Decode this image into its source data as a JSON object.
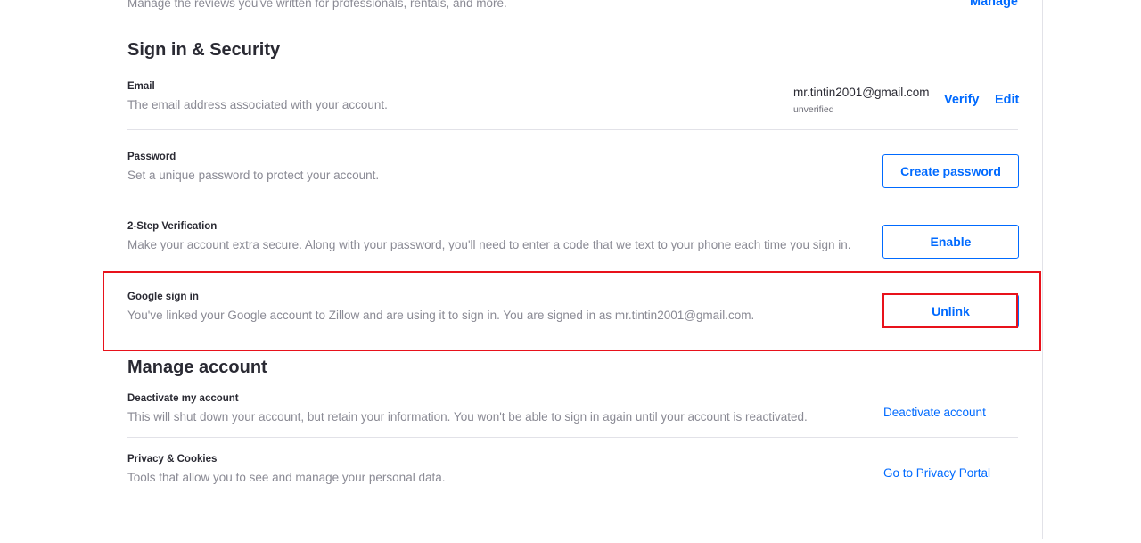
{
  "reviews": {
    "description": "Manage the reviews you've written for professionals, rentals, and more.",
    "manage_link": "Manage"
  },
  "sign_in_security": {
    "title": "Sign in & Security",
    "email": {
      "title": "Email",
      "description": "The email address associated with your account.",
      "value": "mr.tintin2001@gmail.com",
      "status": "unverified",
      "verify_link": "Verify",
      "edit_link": "Edit"
    },
    "password": {
      "title": "Password",
      "description": "Set a unique password to protect your account.",
      "button": "Create password"
    },
    "two_step": {
      "title": "2-Step Verification",
      "description": "Make your account extra secure. Along with your password, you'll need to enter a code that we text to your phone each time you sign in.",
      "button": "Enable"
    },
    "google": {
      "title": "Google sign in",
      "description": "You've linked your Google account to Zillow and are using it to sign in. You are signed in as mr.tintin2001@gmail.com.",
      "button": "Unlink"
    }
  },
  "manage_account": {
    "title": "Manage account",
    "deactivate": {
      "title": "Deactivate my account",
      "description": "This will shut down your account, but retain your information. You won't be able to sign in again until your account is reactivated.",
      "link": "Deactivate account"
    },
    "privacy": {
      "title": "Privacy & Cookies",
      "description": "Tools that allow you to see and manage your personal data.",
      "link": "Go to Privacy Portal"
    }
  },
  "colors": {
    "accent": "#006aff",
    "highlight": "#e8121b",
    "muted_text": "#8a8a94",
    "primary_text": "#2a2a33"
  }
}
